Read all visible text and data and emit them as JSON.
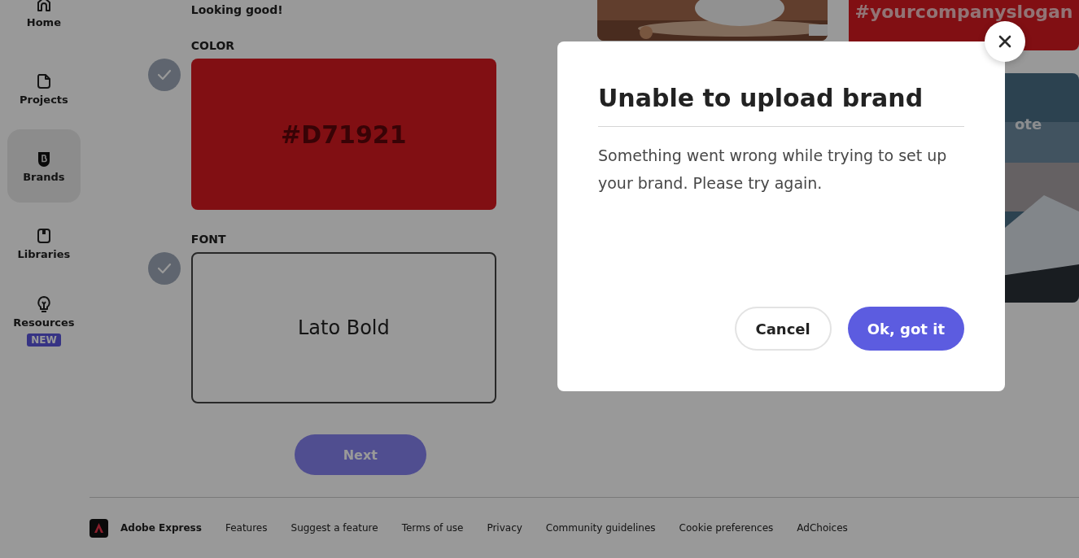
{
  "sidebar": {
    "items": [
      {
        "label": "Home",
        "selected": false
      },
      {
        "label": "Projects",
        "selected": false
      },
      {
        "label": "Brands",
        "selected": true
      },
      {
        "label": "Libraries",
        "selected": false
      },
      {
        "label": "Resources",
        "selected": false,
        "badge": "NEW"
      }
    ]
  },
  "brand_setup": {
    "status": "Looking good!",
    "sections": [
      {
        "kind": "color",
        "heading": "COLOR",
        "checked": true,
        "value": "#D71921"
      },
      {
        "kind": "font",
        "heading": "FONT",
        "checked": true,
        "value": "Lato Bold"
      }
    ],
    "next_button": "Next"
  },
  "templates": [
    {
      "kind": "picture"
    },
    {
      "kind": "slogan",
      "text": "#yourcompanyslogan"
    },
    {
      "kind": "picture",
      "text": "ote"
    }
  ],
  "dialog": {
    "title": "Unable to upload brand",
    "message": "Something went wrong while trying to set up your brand. Please try again.",
    "buttons": [
      {
        "label": "Cancel",
        "primary": false
      },
      {
        "label": "Ok, got it",
        "primary": true
      }
    ]
  },
  "footer": {
    "brand": "Adobe Express",
    "links": [
      "Features",
      "Suggest a feature",
      "Terms of use",
      "Privacy",
      "Community guidelines",
      "Cookie preferences",
      "AdChoices"
    ]
  }
}
